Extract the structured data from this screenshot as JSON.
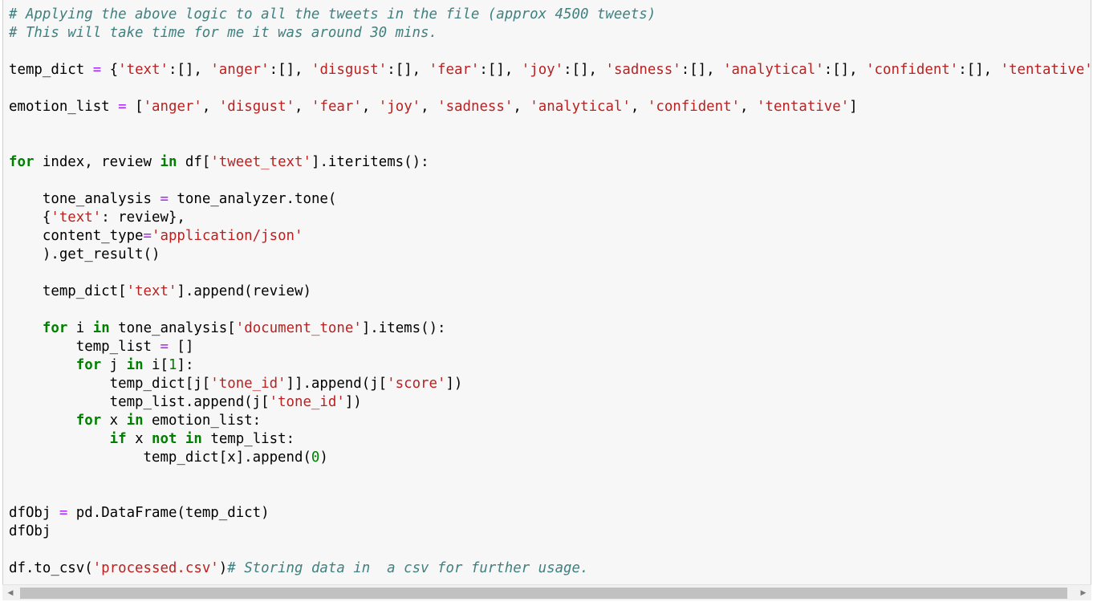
{
  "code_lines": [
    [
      {
        "t": "c",
        "v": "# Applying the above logic to all the tweets in the file (approx 4500 tweets)"
      }
    ],
    [
      {
        "t": "c",
        "v": "# This will take time for me it was around 30 mins."
      }
    ],
    [],
    [
      {
        "t": "p",
        "v": "temp_dict "
      },
      {
        "t": "o",
        "v": "="
      },
      {
        "t": "p",
        "v": " {"
      },
      {
        "t": "s",
        "v": "'text'"
      },
      {
        "t": "p",
        "v": ":[], "
      },
      {
        "t": "s",
        "v": "'anger'"
      },
      {
        "t": "p",
        "v": ":[], "
      },
      {
        "t": "s",
        "v": "'disgust'"
      },
      {
        "t": "p",
        "v": ":[], "
      },
      {
        "t": "s",
        "v": "'fear'"
      },
      {
        "t": "p",
        "v": ":[], "
      },
      {
        "t": "s",
        "v": "'joy'"
      },
      {
        "t": "p",
        "v": ":[], "
      },
      {
        "t": "s",
        "v": "'sadness'"
      },
      {
        "t": "p",
        "v": ":[], "
      },
      {
        "t": "s",
        "v": "'analytical'"
      },
      {
        "t": "p",
        "v": ":[], "
      },
      {
        "t": "s",
        "v": "'confident'"
      },
      {
        "t": "p",
        "v": ":[], "
      },
      {
        "t": "s",
        "v": "'tentative'"
      }
    ],
    [],
    [
      {
        "t": "p",
        "v": "emotion_list "
      },
      {
        "t": "o",
        "v": "="
      },
      {
        "t": "p",
        "v": " ["
      },
      {
        "t": "s",
        "v": "'anger'"
      },
      {
        "t": "p",
        "v": ", "
      },
      {
        "t": "s",
        "v": "'disgust'"
      },
      {
        "t": "p",
        "v": ", "
      },
      {
        "t": "s",
        "v": "'fear'"
      },
      {
        "t": "p",
        "v": ", "
      },
      {
        "t": "s",
        "v": "'joy'"
      },
      {
        "t": "p",
        "v": ", "
      },
      {
        "t": "s",
        "v": "'sadness'"
      },
      {
        "t": "p",
        "v": ", "
      },
      {
        "t": "s",
        "v": "'analytical'"
      },
      {
        "t": "p",
        "v": ", "
      },
      {
        "t": "s",
        "v": "'confident'"
      },
      {
        "t": "p",
        "v": ", "
      },
      {
        "t": "s",
        "v": "'tentative'"
      },
      {
        "t": "p",
        "v": "]"
      }
    ],
    [],
    [],
    [
      {
        "t": "k",
        "v": "for"
      },
      {
        "t": "p",
        "v": " index, review "
      },
      {
        "t": "k",
        "v": "in"
      },
      {
        "t": "p",
        "v": " df["
      },
      {
        "t": "s",
        "v": "'tweet_text'"
      },
      {
        "t": "p",
        "v": "].iteritems():"
      }
    ],
    [],
    [
      {
        "t": "p",
        "v": "    tone_analysis "
      },
      {
        "t": "o",
        "v": "="
      },
      {
        "t": "p",
        "v": " tone_analyzer.tone("
      }
    ],
    [
      {
        "t": "p",
        "v": "    {"
      },
      {
        "t": "s",
        "v": "'text'"
      },
      {
        "t": "p",
        "v": ": review},"
      }
    ],
    [
      {
        "t": "p",
        "v": "    content_type"
      },
      {
        "t": "o",
        "v": "="
      },
      {
        "t": "s",
        "v": "'application/json'"
      }
    ],
    [
      {
        "t": "p",
        "v": "    ).get_result()"
      }
    ],
    [],
    [
      {
        "t": "p",
        "v": "    temp_dict["
      },
      {
        "t": "s",
        "v": "'text'"
      },
      {
        "t": "p",
        "v": "].append(review)"
      }
    ],
    [],
    [
      {
        "t": "p",
        "v": "    "
      },
      {
        "t": "k",
        "v": "for"
      },
      {
        "t": "p",
        "v": " i "
      },
      {
        "t": "k",
        "v": "in"
      },
      {
        "t": "p",
        "v": " tone_analysis["
      },
      {
        "t": "s",
        "v": "'document_tone'"
      },
      {
        "t": "p",
        "v": "].items():"
      }
    ],
    [
      {
        "t": "p",
        "v": "        temp_list "
      },
      {
        "t": "o",
        "v": "="
      },
      {
        "t": "p",
        "v": " []"
      }
    ],
    [
      {
        "t": "p",
        "v": "        "
      },
      {
        "t": "k",
        "v": "for"
      },
      {
        "t": "p",
        "v": " j "
      },
      {
        "t": "k",
        "v": "in"
      },
      {
        "t": "p",
        "v": " i["
      },
      {
        "t": "n",
        "v": "1"
      },
      {
        "t": "p",
        "v": "]:"
      }
    ],
    [
      {
        "t": "p",
        "v": "            temp_dict[j["
      },
      {
        "t": "s",
        "v": "'tone_id'"
      },
      {
        "t": "p",
        "v": "]].append(j["
      },
      {
        "t": "s",
        "v": "'score'"
      },
      {
        "t": "p",
        "v": "])"
      }
    ],
    [
      {
        "t": "p",
        "v": "            temp_list.append(j["
      },
      {
        "t": "s",
        "v": "'tone_id'"
      },
      {
        "t": "p",
        "v": "])"
      }
    ],
    [
      {
        "t": "p",
        "v": "        "
      },
      {
        "t": "k",
        "v": "for"
      },
      {
        "t": "p",
        "v": " x "
      },
      {
        "t": "k",
        "v": "in"
      },
      {
        "t": "p",
        "v": " emotion_list:"
      }
    ],
    [
      {
        "t": "p",
        "v": "            "
      },
      {
        "t": "k",
        "v": "if"
      },
      {
        "t": "p",
        "v": " x "
      },
      {
        "t": "k",
        "v": "not"
      },
      {
        "t": "p",
        "v": " "
      },
      {
        "t": "k",
        "v": "in"
      },
      {
        "t": "p",
        "v": " temp_list:"
      }
    ],
    [
      {
        "t": "p",
        "v": "                temp_dict[x].append("
      },
      {
        "t": "n",
        "v": "0"
      },
      {
        "t": "p",
        "v": ")"
      }
    ],
    [],
    [],
    [
      {
        "t": "p",
        "v": "dfObj "
      },
      {
        "t": "o",
        "v": "="
      },
      {
        "t": "p",
        "v": " pd.DataFrame(temp_dict)"
      }
    ],
    [
      {
        "t": "p",
        "v": "dfObj"
      }
    ],
    [],
    [
      {
        "t": "p",
        "v": "df.to_csv("
      },
      {
        "t": "s",
        "v": "'processed.csv'"
      },
      {
        "t": "p",
        "v": ")"
      },
      {
        "t": "c",
        "v": "# Storing data in  a csv for further usage."
      }
    ]
  ],
  "scrollbar": {
    "left_icon": "triangle-left-icon",
    "right_icon": "triangle-right-icon",
    "left_glyph": "◀",
    "right_glyph": "▶",
    "thumb_fraction": 0.96
  },
  "colors": {
    "comment": "#408080",
    "string": "#ba2121",
    "keyword": "#008000",
    "operator": "#aa22ff",
    "number": "#008000",
    "cell_bg": "#f7f7f7"
  }
}
